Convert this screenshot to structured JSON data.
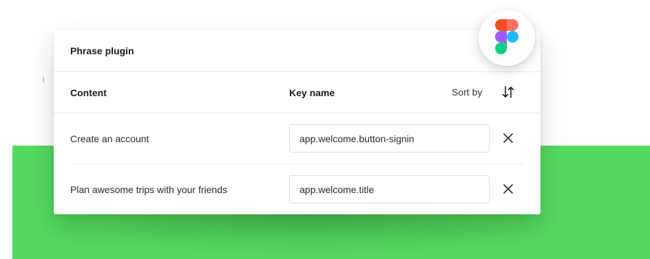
{
  "plugin": {
    "title": "Phrase plugin"
  },
  "columns": {
    "content": "Content",
    "key_name": "Key name",
    "sort_label": "Sort by"
  },
  "rows": [
    {
      "content": "Create an account",
      "key": "app.welcome.button-signin"
    },
    {
      "content": "Plan awesome trips with your friends",
      "key": "app.welcome.title"
    }
  ],
  "icons": {
    "sort": "sort-icon",
    "remove": "close-icon",
    "logo": "figma-logo-icon"
  },
  "colors": {
    "background_band": "#53d95f",
    "panel": "#ffffff",
    "text": "#1b1b1b",
    "logo_red": "#f24e1e",
    "logo_orange": "#ff7262",
    "logo_purple": "#a259ff",
    "logo_blue": "#1abcfe",
    "logo_green": "#0acf83"
  }
}
